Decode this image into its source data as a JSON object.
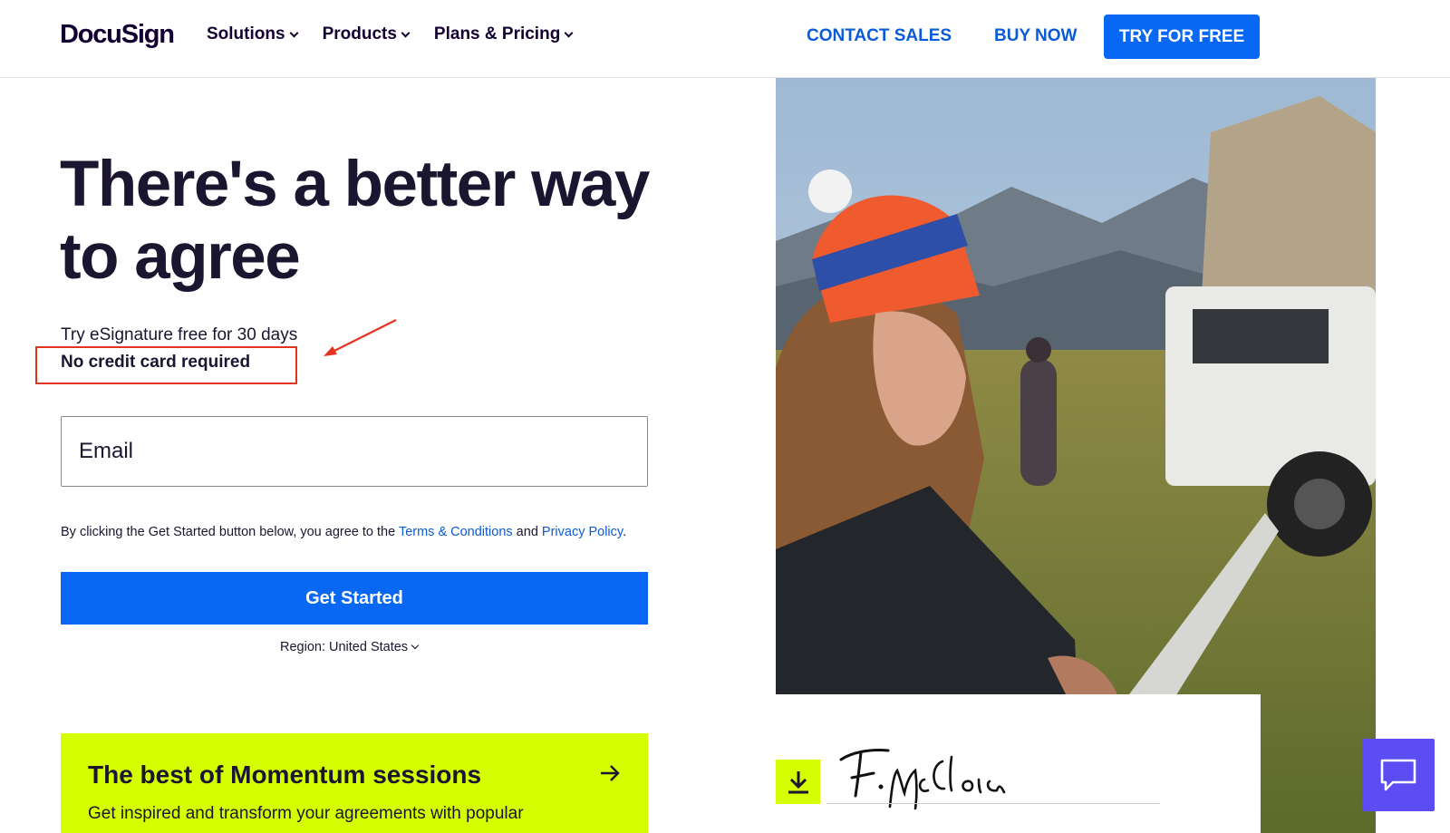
{
  "header": {
    "logo": "DocuSign",
    "nav": [
      {
        "label": "Solutions"
      },
      {
        "label": "Products"
      },
      {
        "label": "Plans & Pricing"
      }
    ],
    "contact_sales": "CONTACT SALES",
    "buy_now": "BUY NOW",
    "try_free": "TRY FOR FREE"
  },
  "hero": {
    "headline": "There's a better way to agree",
    "subtitle": "Try eSignature free for 30 days",
    "no_card": "No credit card required",
    "email_placeholder": "Email",
    "terms_prefix": "By clicking the Get Started button below, you agree to the ",
    "terms_link": "Terms & Conditions",
    "terms_and": " and ",
    "privacy_link": "Privacy Policy",
    "terms_suffix": ".",
    "get_started": "Get Started",
    "region": "Region: United States"
  },
  "promo": {
    "title": "The best of Momentum sessions",
    "text": "Get inspired and transform your agreements with popular"
  },
  "signature_card": {
    "signature": "F. McClain"
  },
  "colors": {
    "brand_blue": "#0868f4",
    "link_blue": "#0a5bd8",
    "accent_lime": "#d5ff00",
    "chat_purple": "#5b4df3",
    "annotation_red": "#e53322"
  },
  "icons": [
    "chevron-down-icon",
    "arrow-right-icon",
    "download-icon",
    "chat-icon"
  ]
}
